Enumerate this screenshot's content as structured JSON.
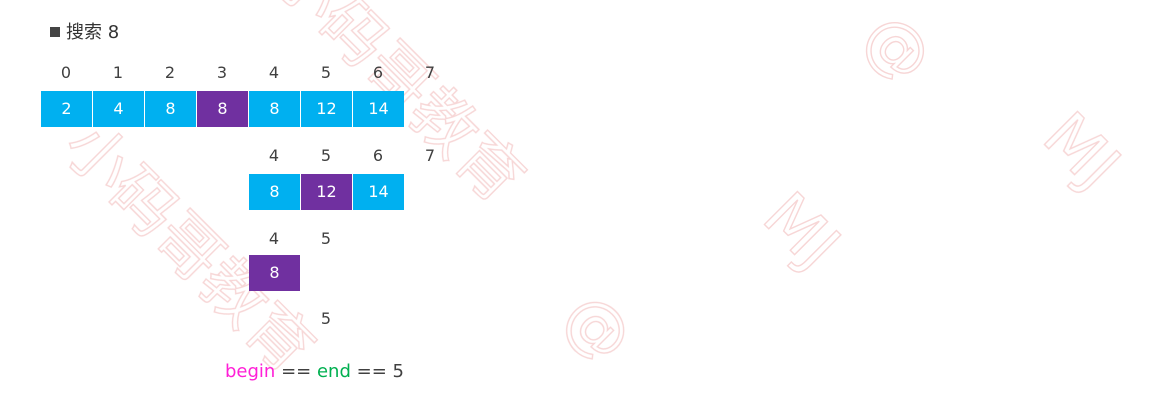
{
  "title": "搜索 8",
  "colors": {
    "cell": "#00b0f0",
    "mid": "#7030a0",
    "begin": "#ff1fd7",
    "end": "#00b050",
    "watermark": "#f6d2d2"
  },
  "rows": [
    {
      "indices": [
        "0",
        "1",
        "2",
        "3",
        "4",
        "5",
        "6",
        "7"
      ],
      "cells": [
        {
          "value": "2",
          "mid": false
        },
        {
          "value": "4",
          "mid": false
        },
        {
          "value": "8",
          "mid": false
        },
        {
          "value": "8",
          "mid": true
        },
        {
          "value": "8",
          "mid": false
        },
        {
          "value": "12",
          "mid": false
        },
        {
          "value": "14",
          "mid": false
        }
      ]
    },
    {
      "indices": [
        "4",
        "5",
        "6",
        "7"
      ],
      "cells": [
        {
          "value": "8",
          "mid": false
        },
        {
          "value": "12",
          "mid": true
        },
        {
          "value": "14",
          "mid": false
        }
      ]
    },
    {
      "indices": [
        "4",
        "5"
      ],
      "cells": [
        {
          "value": "8",
          "mid": true
        }
      ]
    },
    {
      "indices": [
        "5"
      ],
      "cells": []
    }
  ],
  "result": {
    "begin": "begin",
    "eq1": "==",
    "end": "end",
    "eq2": "==",
    "value": "5"
  },
  "watermark": [
    "小码哥教育",
    "@",
    "MJ",
    "小码哥教育",
    "@",
    "MJ"
  ]
}
